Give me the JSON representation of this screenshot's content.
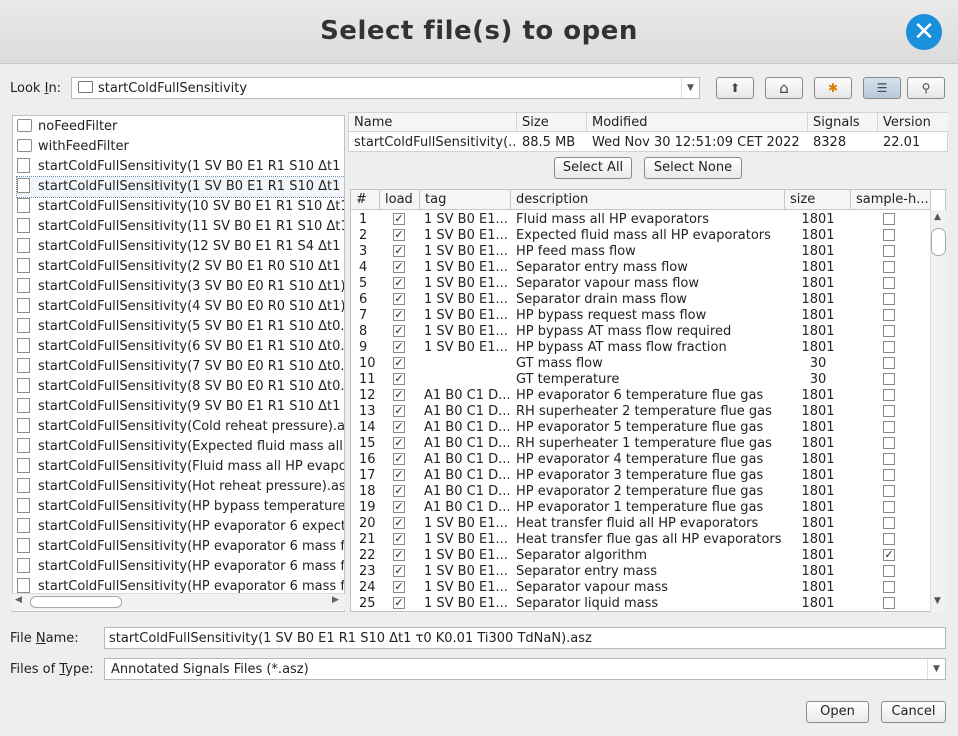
{
  "dialog": {
    "title": "Select file(s) to open",
    "close_glyph": "✕"
  },
  "look_in": {
    "label_pre": "Look ",
    "label_mn": "I",
    "label_post": "n:",
    "value": "startColdFullSensitivity",
    "arrow": "▼"
  },
  "toolbar": {
    "up_icon": "⬆",
    "home_icon": "⌂",
    "new_folder_icon": "✱",
    "list_icon": "☰",
    "details_icon": "⚲"
  },
  "file_list": [
    {
      "name": "noFeedFilter",
      "type": "folder"
    },
    {
      "name": "withFeedFilter",
      "type": "folder"
    },
    {
      "name": "startColdFullSensitivity(1 SV B0 E1 R1 S10 Δt1 τ0",
      "type": "file"
    },
    {
      "name": "startColdFullSensitivity(1 SV B0 E1 R1 S10 Δt1 τ0",
      "type": "file",
      "selected": true
    },
    {
      "name": "startColdFullSensitivity(10 SV B0 E1 R1 S10 Δt1 τ0",
      "type": "file"
    },
    {
      "name": "startColdFullSensitivity(11 SV B0 E1 R1 S10 Δt1 τ0",
      "type": "file"
    },
    {
      "name": "startColdFullSensitivity(12 SV B0 E1 R1 S4 Δt1 τ0",
      "type": "file"
    },
    {
      "name": "startColdFullSensitivity(2 SV B0 E1 R0 S10 Δt1 τ0",
      "type": "file"
    },
    {
      "name": "startColdFullSensitivity(3 SV B0 E0 R1 S10 Δt1).as",
      "type": "file"
    },
    {
      "name": "startColdFullSensitivity(4 SV B0 E0 R0 S10 Δt1).as",
      "type": "file"
    },
    {
      "name": "startColdFullSensitivity(5 SV B0 E1 R1 S10 Δt0.01",
      "type": "file"
    },
    {
      "name": "startColdFullSensitivity(6 SV B0 E1 R1 S10 Δt0.1 τ",
      "type": "file"
    },
    {
      "name": "startColdFullSensitivity(7 SV B0 E0 R1 S10 Δt0.01",
      "type": "file"
    },
    {
      "name": "startColdFullSensitivity(8 SV B0 E0 R1 S10 Δt0.1).",
      "type": "file"
    },
    {
      "name": "startColdFullSensitivity(9 SV B0 E1 R1 S10 Δt1 τ0",
      "type": "file"
    },
    {
      "name": "startColdFullSensitivity(Cold reheat pressure).asz",
      "type": "file"
    },
    {
      "name": "startColdFullSensitivity(Expected fluid mass all HP",
      "type": "file"
    },
    {
      "name": "startColdFullSensitivity(Fluid mass all HP evaporat",
      "type": "file"
    },
    {
      "name": "startColdFullSensitivity(Hot reheat pressure).asz",
      "type": "file"
    },
    {
      "name": "startColdFullSensitivity(HP bypass temperature).as",
      "type": "file"
    },
    {
      "name": "startColdFullSensitivity(HP evaporator 6 expected",
      "type": "file"
    },
    {
      "name": "startColdFullSensitivity(HP evaporator 6 mass flow",
      "type": "file"
    },
    {
      "name": "startColdFullSensitivity(HP evaporator 6 mass flow",
      "type": "file"
    },
    {
      "name": "startColdFullSensitivity(HP evaporator 6 mass flui",
      "type": "file"
    }
  ],
  "hscroll": {
    "left": "◀",
    "right": "▶"
  },
  "info_table": {
    "headers": [
      "Name",
      "Size",
      "Modified",
      "Signals",
      "Version"
    ],
    "row": [
      "startColdFullSensitivity(...",
      "88.5 MB",
      "Wed Nov 30 12:51:09 CET 2022",
      "8328",
      "22.01"
    ]
  },
  "buttons": {
    "select_all": "Select All",
    "select_none": "Select None",
    "open": "Open",
    "cancel": "Cancel"
  },
  "signals": {
    "headers": [
      "#",
      "load",
      "tag",
      "description",
      "size",
      "sample-h..."
    ],
    "rows": [
      {
        "n": "1",
        "load": true,
        "tag": "1 SV B0 E1...",
        "desc": "Fluid mass all HP evaporators",
        "size": "1801",
        "sh": false
      },
      {
        "n": "2",
        "load": true,
        "tag": "1 SV B0 E1...",
        "desc": "Expected fluid mass all HP evaporators",
        "size": "1801",
        "sh": false
      },
      {
        "n": "3",
        "load": true,
        "tag": "1 SV B0 E1...",
        "desc": "HP feed mass flow",
        "size": "1801",
        "sh": false
      },
      {
        "n": "4",
        "load": true,
        "tag": "1 SV B0 E1...",
        "desc": "Separator entry mass flow",
        "size": "1801",
        "sh": false
      },
      {
        "n": "5",
        "load": true,
        "tag": "1 SV B0 E1...",
        "desc": "Separator vapour mass flow",
        "size": "1801",
        "sh": false
      },
      {
        "n": "6",
        "load": true,
        "tag": "1 SV B0 E1...",
        "desc": "Separator drain mass flow",
        "size": "1801",
        "sh": false
      },
      {
        "n": "7",
        "load": true,
        "tag": "1 SV B0 E1...",
        "desc": "HP bypass request mass flow",
        "size": "1801",
        "sh": false
      },
      {
        "n": "8",
        "load": true,
        "tag": "1 SV B0 E1...",
        "desc": "HP bypass AT mass flow required",
        "size": "1801",
        "sh": false
      },
      {
        "n": "9",
        "load": true,
        "tag": "1 SV B0 E1...",
        "desc": "HP bypass AT mass flow fraction",
        "size": "1801",
        "sh": false
      },
      {
        "n": "10",
        "load": true,
        "tag": "",
        "desc": "GT mass flow",
        "size": "30",
        "sh": false
      },
      {
        "n": "11",
        "load": true,
        "tag": "",
        "desc": "GT temperature",
        "size": "30",
        "sh": false
      },
      {
        "n": "12",
        "load": true,
        "tag": "A1 B0 C1 D...",
        "desc": "HP evaporator 6 temperature flue gas",
        "size": "1801",
        "sh": false
      },
      {
        "n": "13",
        "load": true,
        "tag": "A1 B0 C1 D...",
        "desc": "RH superheater 2 temperature flue gas",
        "size": "1801",
        "sh": false
      },
      {
        "n": "14",
        "load": true,
        "tag": "A1 B0 C1 D...",
        "desc": "HP evaporator 5 temperature flue gas",
        "size": "1801",
        "sh": false
      },
      {
        "n": "15",
        "load": true,
        "tag": "A1 B0 C1 D...",
        "desc": "RH superheater 1 temperature flue gas",
        "size": "1801",
        "sh": false
      },
      {
        "n": "16",
        "load": true,
        "tag": "A1 B0 C1 D...",
        "desc": "HP evaporator 4 temperature flue gas",
        "size": "1801",
        "sh": false
      },
      {
        "n": "17",
        "load": true,
        "tag": "A1 B0 C1 D...",
        "desc": "HP evaporator 3 temperature flue gas",
        "size": "1801",
        "sh": false
      },
      {
        "n": "18",
        "load": true,
        "tag": "A1 B0 C1 D...",
        "desc": "HP evaporator 2 temperature flue gas",
        "size": "1801",
        "sh": false
      },
      {
        "n": "19",
        "load": true,
        "tag": "A1 B0 C1 D...",
        "desc": "HP evaporator 1 temperature flue gas",
        "size": "1801",
        "sh": false
      },
      {
        "n": "20",
        "load": true,
        "tag": "1 SV B0 E1...",
        "desc": "Heat transfer fluid all HP evaporators",
        "size": "1801",
        "sh": false
      },
      {
        "n": "21",
        "load": true,
        "tag": "1 SV B0 E1...",
        "desc": "Heat transfer flue gas all HP evaporators",
        "size": "1801",
        "sh": false
      },
      {
        "n": "22",
        "load": true,
        "tag": "1 SV B0 E1...",
        "desc": "Separator algorithm",
        "size": "1801",
        "sh": true
      },
      {
        "n": "23",
        "load": true,
        "tag": "1 SV B0 E1...",
        "desc": "Separator entry mass",
        "size": "1801",
        "sh": false
      },
      {
        "n": "24",
        "load": true,
        "tag": "1 SV B0 E1...",
        "desc": "Separator vapour mass",
        "size": "1801",
        "sh": false
      },
      {
        "n": "25",
        "load": true,
        "tag": "1 SV B0 E1...",
        "desc": "Separator liquid mass",
        "size": "1801",
        "sh": false
      }
    ]
  },
  "vscroll": {
    "up": "▲",
    "down": "▼"
  },
  "file_name": {
    "label_pre": "File ",
    "label_mn": "N",
    "label_post": "ame:",
    "value": "startColdFullSensitivity(1 SV B0 E1 R1 S10 Δt1 τ0 K0.01 Ti300 TdNaN).asz"
  },
  "file_type": {
    "label_pre": "Files of ",
    "label_mn": "T",
    "label_post": "ype:",
    "value": "Annotated Signals Files (*.asz)",
    "arrow": "▼"
  },
  "check_glyph": "✓"
}
